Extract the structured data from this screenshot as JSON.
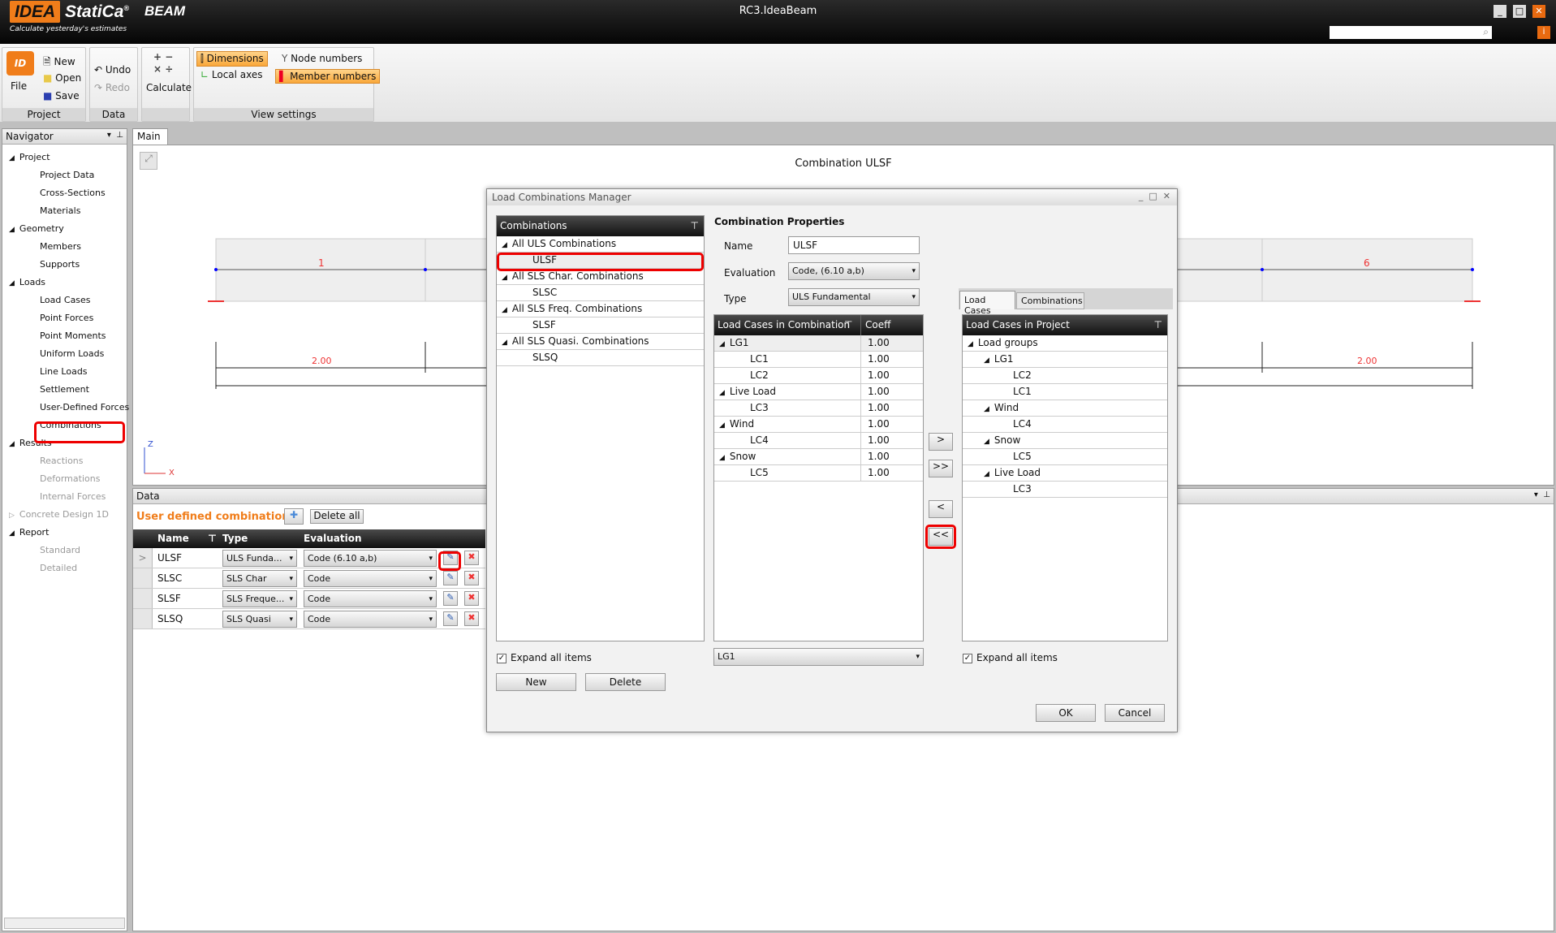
{
  "app": {
    "logo": "IDEA StatiCa®",
    "tagline": "Calculate yesterday's estimates",
    "product": "BEAM",
    "window_title": "RC3.IdeaBeam"
  },
  "ribbon": {
    "file": "File",
    "new": "New",
    "open": "Open",
    "save": "Save",
    "project": "Project",
    "undo": "Undo",
    "redo": "Redo",
    "data": "Data",
    "calculate": "Calculate",
    "dimensions": "Dimensions",
    "local_axes": "Local axes",
    "node_numbers": "Node numbers",
    "member_numbers": "Member numbers",
    "view_settings": "View settings"
  },
  "navigator": {
    "title": "Navigator",
    "items": [
      {
        "label": "Project",
        "level": 0
      },
      {
        "label": "Project Data",
        "level": 1
      },
      {
        "label": "Cross-Sections",
        "level": 1
      },
      {
        "label": "Materials",
        "level": 1
      },
      {
        "label": "Geometry",
        "level": 0
      },
      {
        "label": "Members",
        "level": 1
      },
      {
        "label": "Supports",
        "level": 1
      },
      {
        "label": "Loads",
        "level": 0
      },
      {
        "label": "Load Cases",
        "level": 1
      },
      {
        "label": "Point Forces",
        "level": 1
      },
      {
        "label": "Point Moments",
        "level": 1
      },
      {
        "label": "Uniform Loads",
        "level": 1
      },
      {
        "label": "Line Loads",
        "level": 1
      },
      {
        "label": "Settlement",
        "level": 1
      },
      {
        "label": "User-Defined Forces",
        "level": 1
      },
      {
        "label": "Combinations",
        "level": 1
      },
      {
        "label": "Results",
        "level": 0
      },
      {
        "label": "Reactions",
        "level": 1
      },
      {
        "label": "Deformations",
        "level": 1
      },
      {
        "label": "Internal Forces",
        "level": 1
      },
      {
        "label": "Concrete Design 1D",
        "level": 0
      },
      {
        "label": "Report",
        "level": 0
      },
      {
        "label": "Standard",
        "level": 1
      },
      {
        "label": "Detailed",
        "level": 1
      }
    ]
  },
  "main": {
    "tab": "Main",
    "title": "Combination ULSF",
    "member_labels": [
      "1",
      "6"
    ],
    "dims": [
      "2.00",
      "2.00"
    ],
    "axis_z": "Z",
    "axis_x": "X"
  },
  "data_panel": {
    "title": "Data",
    "heading": "User defined combinations",
    "delete_all": "Delete all",
    "columns": [
      "Name",
      "Type",
      "Evaluation"
    ],
    "rows": [
      {
        "name": "ULSF",
        "type": "ULS Funda...",
        "evaluation": "Code (6.10 a,b)"
      },
      {
        "name": "SLSC",
        "type": "SLS Char",
        "evaluation": "Code"
      },
      {
        "name": "SLSF",
        "type": "SLS Freque...",
        "evaluation": "Code"
      },
      {
        "name": "SLSQ",
        "type": "SLS Quasi",
        "evaluation": "Code"
      }
    ]
  },
  "dialog": {
    "title": "Load Combinations Manager",
    "combinations_header": "Combinations",
    "combinations": [
      {
        "label": "All ULS Combinations",
        "group": true
      },
      {
        "label": "ULSF"
      },
      {
        "label": "All SLS Char. Combinations",
        "group": true
      },
      {
        "label": "SLSC"
      },
      {
        "label": "All SLS Freq. Combinations",
        "group": true
      },
      {
        "label": "SLSF"
      },
      {
        "label": "All SLS Quasi. Combinations",
        "group": true
      },
      {
        "label": "SLSQ"
      }
    ],
    "props_title": "Combination Properties",
    "name_label": "Name",
    "name_value": "ULSF",
    "evaluation_label": "Evaluation",
    "evaluation_value": "Code, (6.10 a,b)",
    "type_label": "Type",
    "type_value": "ULS Fundamental",
    "lc_header": "Load Cases in Combination",
    "coeff_header": "Coeff",
    "lc_rows": [
      {
        "label": "LG1",
        "group": true,
        "coeff": "1.00"
      },
      {
        "label": "LC1",
        "coeff": "1.00"
      },
      {
        "label": "LC2",
        "coeff": "1.00"
      },
      {
        "label": "Live Load",
        "group": true,
        "coeff": "1.00"
      },
      {
        "label": "LC3",
        "coeff": "1.00"
      },
      {
        "label": "Wind",
        "group": true,
        "coeff": "1.00"
      },
      {
        "label": "LC4",
        "coeff": "1.00"
      },
      {
        "label": "Snow",
        "group": true,
        "coeff": "1.00"
      },
      {
        "label": "LC5",
        "coeff": "1.00"
      }
    ],
    "move": [
      ">",
      ">>",
      "<",
      "<<"
    ],
    "tabs": [
      "Load Cases",
      "Combinations"
    ],
    "project_header": "Load Cases in Project",
    "project_rows": [
      {
        "label": "Load groups",
        "level": 0
      },
      {
        "label": "LG1",
        "level": 1
      },
      {
        "label": "LC2",
        "level": 2
      },
      {
        "label": "LC1",
        "level": 2
      },
      {
        "label": "Wind",
        "level": 1
      },
      {
        "label": "LC4",
        "level": 2
      },
      {
        "label": "Snow",
        "level": 1
      },
      {
        "label": "LC5",
        "level": 2
      },
      {
        "label": "Live Load",
        "level": 1
      },
      {
        "label": "LC3",
        "level": 2
      }
    ],
    "expand_all": "Expand all items",
    "lg_select": "LG1",
    "new": "New",
    "delete": "Delete",
    "ok": "OK",
    "cancel": "Cancel"
  }
}
